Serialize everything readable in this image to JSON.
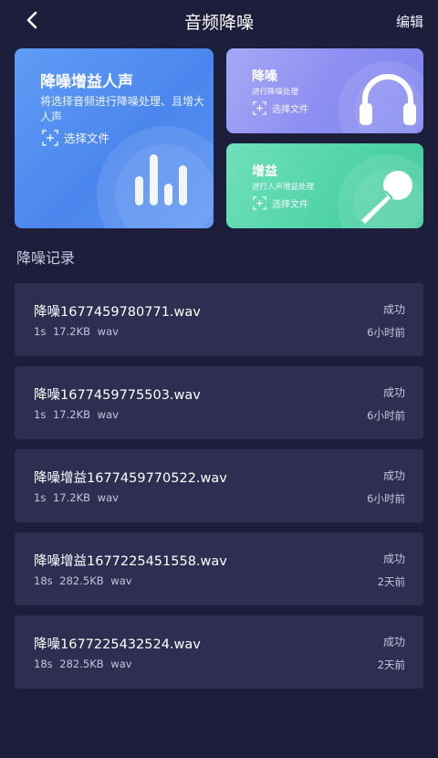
{
  "header": {
    "title": "音频降噪",
    "edit_label": "编辑"
  },
  "cards": {
    "enhance_voice": {
      "title": "降噪增益人声",
      "description": "将选择音频进行降噪处理、且增大人声",
      "select_label": "选择文件"
    },
    "denoise": {
      "title": "降噪",
      "description": "进行降噪处理",
      "select_label": "选择文件"
    },
    "gain": {
      "title": "增益",
      "description": "进行人声增益处理",
      "select_label": "选择文件"
    }
  },
  "section_title": "降噪记录",
  "records": [
    {
      "name": "降噪1677459780771.wav",
      "duration": "1s",
      "size": "17.2KB",
      "format": "wav",
      "status": "成功",
      "time": "6小时前"
    },
    {
      "name": "降噪1677459775503.wav",
      "duration": "1s",
      "size": "17.2KB",
      "format": "wav",
      "status": "成功",
      "time": "6小时前"
    },
    {
      "name": "降噪增益1677459770522.wav",
      "duration": "1s",
      "size": "17.2KB",
      "format": "wav",
      "status": "成功",
      "time": "6小时前"
    },
    {
      "name": "降噪增益1677225451558.wav",
      "duration": "18s",
      "size": "282.5KB",
      "format": "wav",
      "status": "成功",
      "time": "2天前"
    },
    {
      "name": "降噪1677225432524.wav",
      "duration": "18s",
      "size": "282.5KB",
      "format": "wav",
      "status": "成功",
      "time": "2天前"
    }
  ],
  "icons": {
    "back": "chevron-left-icon",
    "select_file": "add-file-icon",
    "equalizer": "equalizer-bars-icon",
    "headphones": "headphones-icon",
    "microphone": "microphone-icon"
  },
  "colors": {
    "background": "#1d1e3c",
    "row_background": "#2d2e52",
    "card_blue": "#5591f2",
    "card_purple": "#8d8ff1",
    "card_green": "#4fd3a5"
  }
}
